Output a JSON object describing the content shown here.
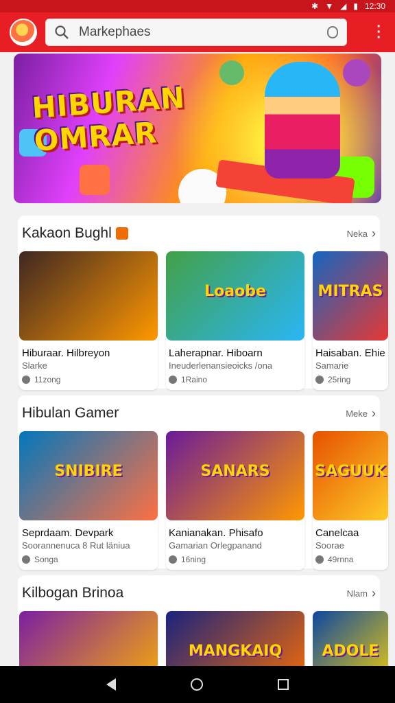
{
  "status_bar": {
    "time": "12:30"
  },
  "search": {
    "text": "Markephaes"
  },
  "banner": {
    "title_line1": "HIBURAN",
    "title_line2": "OMRAR"
  },
  "sections": [
    {
      "title": "Kakaon Bughl",
      "more": "Neka",
      "cards": [
        {
          "title": "Hiburaar. Hilbreyon",
          "subtitle": "Slarke",
          "meta": "11zong",
          "thumb_text": "",
          "colors": [
            "#3e2723",
            "#ff9800"
          ]
        },
        {
          "title": "Laherapnar. Hiboarn",
          "subtitle": "Ineuderlenansieoicks /ona",
          "meta": "1Raino",
          "thumb_text": "Loaobe",
          "colors": [
            "#43a047",
            "#29b6f6"
          ]
        },
        {
          "title": "Haisaban. Ehie",
          "subtitle": "Samarie",
          "meta": "25ring",
          "thumb_text": "MITRAS",
          "colors": [
            "#1565c0",
            "#e53935"
          ]
        }
      ]
    },
    {
      "title": "Hibulan Gamer",
      "more": "Meke",
      "cards": [
        {
          "title": "Seprdaam. Devpark",
          "subtitle": "Soorannenuca 8 Rut läniua",
          "meta": "Songa",
          "thumb_text": "SNIBIRE",
          "colors": [
            "#0277bd",
            "#ff7043"
          ]
        },
        {
          "title": "Kanianakan. Phisafo",
          "subtitle": "Gamarian Orlegpanand",
          "meta": "16ning",
          "thumb_text": "SANARS",
          "colors": [
            "#6a1b9a",
            "#ff9800"
          ]
        },
        {
          "title": "Canelcaa",
          "subtitle": "Soorae",
          "meta": "49rnna",
          "thumb_text": "SAGUUK",
          "colors": [
            "#e65100",
            "#ffca28"
          ]
        }
      ]
    },
    {
      "title": "Kilbogan Brinoa",
      "more": "Nlam",
      "cards": [
        {
          "title": "",
          "subtitle": "",
          "meta": "",
          "thumb_text": "",
          "colors": [
            "#7b1fa2",
            "#ffb300"
          ]
        },
        {
          "title": "",
          "subtitle": "",
          "meta": "",
          "thumb_text": "MANGKAIQ",
          "colors": [
            "#1a237e",
            "#ff6f00"
          ]
        },
        {
          "title": "",
          "subtitle": "",
          "meta": "",
          "thumb_text": "ADOLE",
          "colors": [
            "#0d47a1",
            "#ffd600"
          ]
        }
      ]
    }
  ]
}
